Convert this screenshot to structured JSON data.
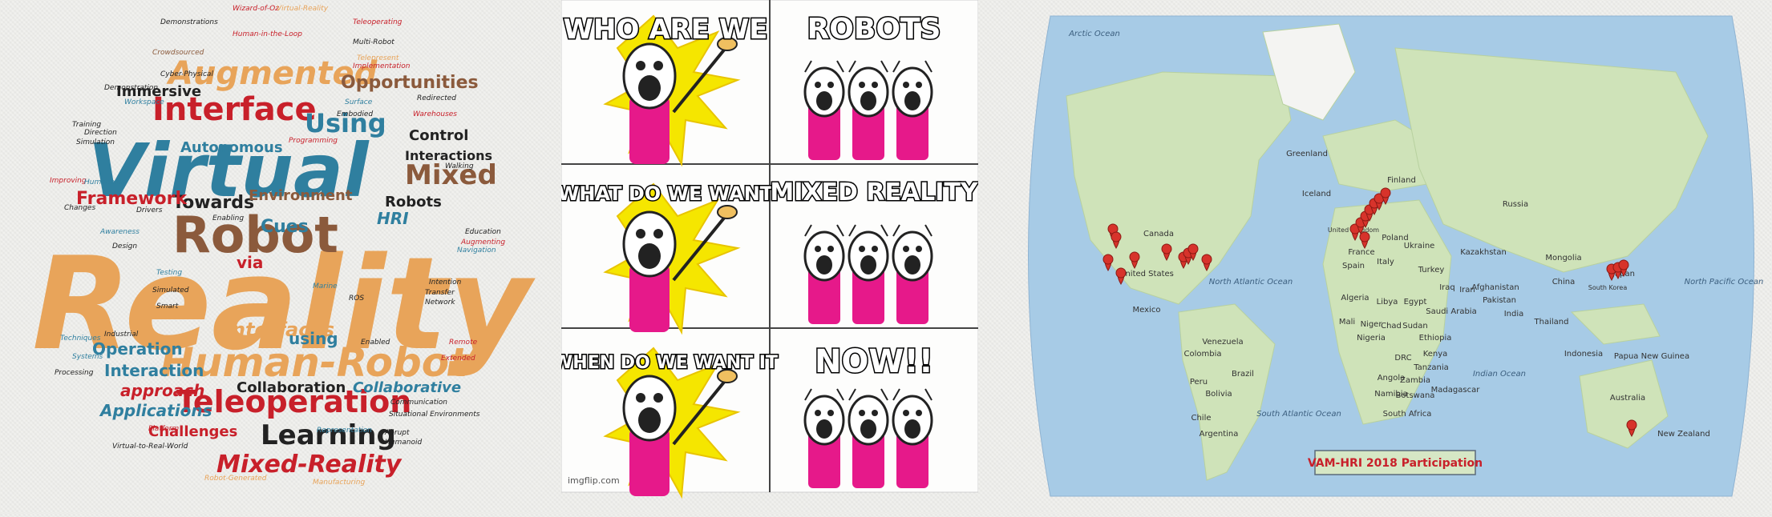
{
  "word_cloud": {
    "words": [
      {
        "text": "Reality",
        "color": "#e8a45a"
      },
      {
        "text": "Virtual",
        "color": "#2f7f9f"
      },
      {
        "text": "Robot",
        "color": "#8b5a3c"
      },
      {
        "text": "Human-Robot",
        "color": "#e8a45a"
      },
      {
        "text": "Teleoperation",
        "color": "#c8202a"
      },
      {
        "text": "Augmented",
        "color": "#e8a45a"
      },
      {
        "text": "Interface",
        "color": "#c8202a"
      },
      {
        "text": "Mixed",
        "color": "#8b5a3c"
      },
      {
        "text": "Learning",
        "color": "#222222"
      },
      {
        "text": "Mixed-Reality",
        "color": "#c8202a"
      },
      {
        "text": "Towards",
        "color": "#222222"
      },
      {
        "text": "Immersive",
        "color": "#222222"
      },
      {
        "text": "Autonomous",
        "color": "#2f7f9f"
      },
      {
        "text": "Opportunities",
        "color": "#8b5a3c"
      },
      {
        "text": "Using",
        "color": "#2f7f9f"
      },
      {
        "text": "Control",
        "color": "#222222"
      },
      {
        "text": "Interactions",
        "color": "#222222"
      },
      {
        "text": "Framework",
        "color": "#c8202a"
      },
      {
        "text": "Environment",
        "color": "#8b5a3c"
      },
      {
        "text": "Robots",
        "color": "#222222"
      },
      {
        "text": "HRI",
        "color": "#2f7f9f"
      },
      {
        "text": "Cues",
        "color": "#2f7f9f"
      },
      {
        "text": "via",
        "color": "#c8202a"
      },
      {
        "text": "Interfaces",
        "color": "#e8a45a"
      },
      {
        "text": "using",
        "color": "#2f7f9f"
      },
      {
        "text": "Operation",
        "color": "#2f7f9f"
      },
      {
        "text": "Interaction",
        "color": "#2f7f9f"
      },
      {
        "text": "approach",
        "color": "#c8202a"
      },
      {
        "text": "Collaboration",
        "color": "#222222"
      },
      {
        "text": "Collaborative",
        "color": "#2f7f9f"
      },
      {
        "text": "Applications",
        "color": "#2f7f9f"
      },
      {
        "text": "Challenges",
        "color": "#c8202a"
      },
      {
        "text": "Wizard-of-Oz",
        "color": "#c8202a"
      },
      {
        "text": "Virtual-Reality",
        "color": "#e8a45a"
      },
      {
        "text": "Human-in-the-Loop",
        "color": "#c8202a"
      },
      {
        "text": "Demonstrations",
        "color": "#222222"
      },
      {
        "text": "Multi-Robot",
        "color": "#222222"
      },
      {
        "text": "Teleoperating",
        "color": "#c8202a"
      },
      {
        "text": "Crowdsourced",
        "color": "#8b5a3c"
      },
      {
        "text": "Cyber-Physical",
        "color": "#222222"
      },
      {
        "text": "Demonstration",
        "color": "#222222"
      },
      {
        "text": "Workspace",
        "color": "#2f7f9f"
      },
      {
        "text": "Training",
        "color": "#222222"
      },
      {
        "text": "Direction",
        "color": "#222222"
      },
      {
        "text": "Simulation",
        "color": "#222222"
      },
      {
        "text": "Improving",
        "color": "#c8202a"
      },
      {
        "text": "Humanoids",
        "color": "#2f7f9f"
      },
      {
        "text": "Changes",
        "color": "#222222"
      },
      {
        "text": "Drivers",
        "color": "#222222"
      },
      {
        "text": "Enabling",
        "color": "#222222"
      },
      {
        "text": "Awareness",
        "color": "#2f7f9f"
      },
      {
        "text": "Design",
        "color": "#222222"
      },
      {
        "text": "Testing",
        "color": "#2f7f9f"
      },
      {
        "text": "Simulated",
        "color": "#222222"
      },
      {
        "text": "Smart",
        "color": "#222222"
      },
      {
        "text": "Industrial",
        "color": "#222222"
      },
      {
        "text": "Techniques",
        "color": "#2f7f9f"
      },
      {
        "text": "Systems",
        "color": "#2f7f9f"
      },
      {
        "text": "Processing",
        "color": "#222222"
      },
      {
        "text": "Platform",
        "color": "#c8202a"
      },
      {
        "text": "Virtual-to-Real-World",
        "color": "#222222"
      },
      {
        "text": "Robot-Generated",
        "color": "#e8a45a"
      },
      {
        "text": "Manufacturing",
        "color": "#e8a45a"
      },
      {
        "text": "Situational Environments",
        "color": "#222222"
      },
      {
        "text": "Communication",
        "color": "#222222"
      },
      {
        "text": "Representation",
        "color": "#2f7f9f"
      },
      {
        "text": "Humanoid",
        "color": "#222222"
      },
      {
        "text": "Abrupt",
        "color": "#222222"
      },
      {
        "text": "Extended",
        "color": "#c8202a"
      },
      {
        "text": "Transfer",
        "color": "#222222"
      },
      {
        "text": "Network",
        "color": "#222222"
      },
      {
        "text": "Intention",
        "color": "#222222"
      },
      {
        "text": "Remote",
        "color": "#c8202a"
      },
      {
        "text": "Navigation",
        "color": "#2f7f9f"
      },
      {
        "text": "Augmenting",
        "color": "#c8202a"
      },
      {
        "text": "Education",
        "color": "#222222"
      },
      {
        "text": "Warehouses",
        "color": "#c8202a"
      },
      {
        "text": "Programming",
        "color": "#c8202a"
      },
      {
        "text": "Walking",
        "color": "#222222"
      },
      {
        "text": "Surface",
        "color": "#2f7f9f"
      },
      {
        "text": "Embodied",
        "color": "#222222"
      },
      {
        "text": "Redirected",
        "color": "#222222"
      },
      {
        "text": "Implementation",
        "color": "#c8202a"
      },
      {
        "text": "Telepresent",
        "color": "#e8a45a"
      },
      {
        "text": "Marine",
        "color": "#2f7f9f"
      },
      {
        "text": "ROS",
        "color": "#222222"
      },
      {
        "text": "Enabled",
        "color": "#222222"
      }
    ]
  },
  "meme": {
    "captions": [
      "WHO ARE WE",
      "ROBOTS",
      "WHAT DO WE WANT",
      "MIXED REALITY",
      "WHEN DO WE WANT IT",
      "NOW!!"
    ],
    "watermark": "imgflip.com"
  },
  "map": {
    "labels": [
      "Arctic Ocean",
      "Greenland",
      "Iceland",
      "Finland",
      "Russia",
      "Canada",
      "United States",
      "Mexico",
      "North Atlantic Ocean",
      "Venezuela",
      "Colombia",
      "Brazil",
      "Peru",
      "Bolivia",
      "Chile",
      "Argentina",
      "South Atlantic Ocean",
      "United Kingdom",
      "Poland",
      "Ukraine",
      "France",
      "Spain",
      "Italy",
      "Turkey",
      "Kazakhstan",
      "Mongolia",
      "China",
      "Japan",
      "South Korea",
      "Iran",
      "Afghanistan",
      "Pakistan",
      "Iraq",
      "Saudi Arabia",
      "India",
      "Thailand",
      "Algeria",
      "Libya",
      "Egypt",
      "Mali",
      "Niger",
      "Chad",
      "Sudan",
      "Nigeria",
      "Ethiopia",
      "Kenya",
      "DRC",
      "Tanzania",
      "Angola",
      "Zambia",
      "Namibia",
      "Botswana",
      "South Africa",
      "Madagascar",
      "Indonesia",
      "Papua New Guinea",
      "Australia",
      "New Zealand",
      "Indian Ocean",
      "North Pacific Ocean"
    ],
    "title": "VAM-HRI  2018 Participation",
    "colors": {
      "ocean": "#a7cbe6",
      "land": "#cfe3b9",
      "marker": "#d7332b",
      "title": "#c8202a"
    }
  }
}
